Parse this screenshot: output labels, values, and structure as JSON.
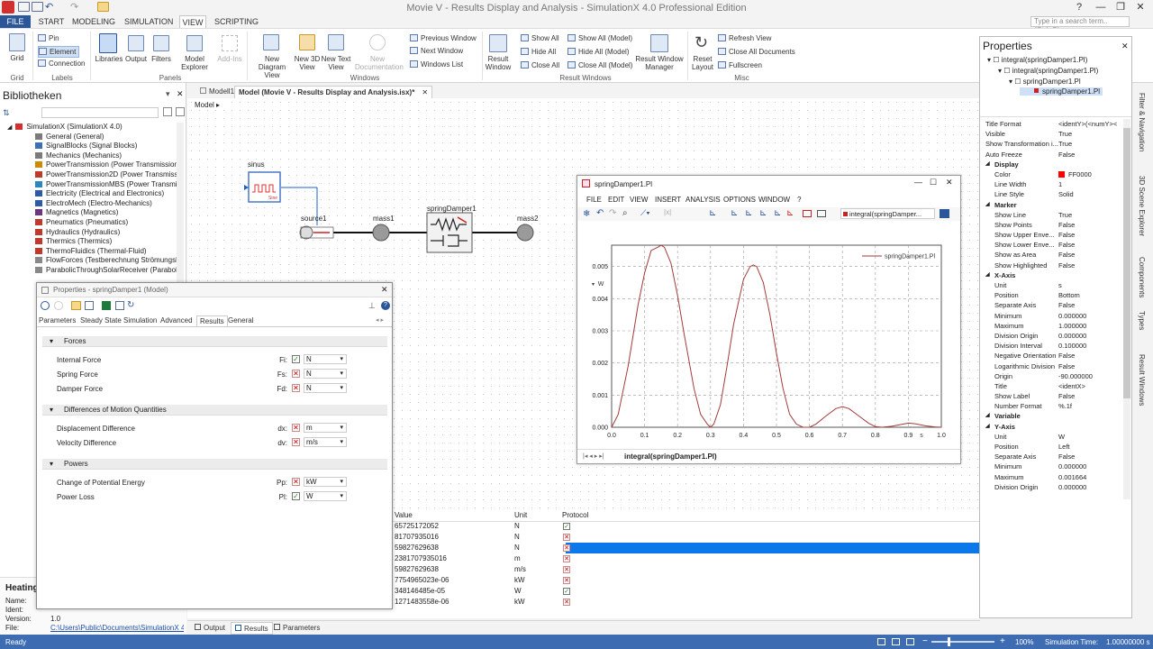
{
  "app": {
    "window_title": "Movie V - Results Display and Analysis - SimulationX 4.0 Professional Edition",
    "search_placeholder": "Type in a search term.. (Ctrl+Q)"
  },
  "menu_tabs": [
    "FILE",
    "START",
    "MODELING",
    "SIMULATION",
    "VIEW",
    "SCRIPTING"
  ],
  "ribbon": {
    "grid_label": "Grid",
    "pin": "Pin",
    "element": "Element",
    "connection": "Connection",
    "libraries": "Libraries",
    "output": "Output",
    "filters": "Filters",
    "model_explorer": "Model Explorer",
    "add_ins": "Add-Ins",
    "new_diagram_view": "New Diagram View",
    "new_3d_view": "New 3D View",
    "new_text_view": "New Text View",
    "new_documentation": "New Documentation",
    "previous_window": "Previous Window",
    "next_window": "Next Window",
    "windows_list": "Windows List",
    "result_window": "Result Window",
    "show_all": "Show All",
    "hide_all": "Hide All",
    "close_all": "Close All",
    "show_all_model": "Show All (Model)",
    "hide_all_model": "Hide All (Model)",
    "close_all_model": "Close All (Model)",
    "result_window_manager": "Result Window Manager",
    "reset_layout": "Reset Layout",
    "refresh_view": "Refresh View",
    "close_all_documents": "Close All Documents",
    "fullscreen": "Fullscreen",
    "groups": {
      "grid": "Grid",
      "labels": "Labels",
      "panels": "Panels",
      "windows": "Windows",
      "result_windows": "Result Windows",
      "misc": "Misc"
    }
  },
  "library": {
    "title": "Bibliotheken",
    "root": "SimulationX (SimulationX 4.0)",
    "items": [
      {
        "label": "General (General)",
        "color": "#7a7a7a"
      },
      {
        "label": "SignalBlocks (Signal Blocks)",
        "color": "#3b6fb6"
      },
      {
        "label": "Mechanics (Mechanics)",
        "color": "#7a7a7a"
      },
      {
        "label": "PowerTransmission (Power Transmission",
        "color": "#d08a00"
      },
      {
        "label": "PowerTransmission2D (Power Transmissi",
        "color": "#c0392b"
      },
      {
        "label": "PowerTransmissionMBS (Power Transmis",
        "color": "#2e86c1"
      },
      {
        "label": "Electricity (Electrical and Electronics)",
        "color": "#2e5aa8"
      },
      {
        "label": "ElectroMech (Electro-Mechanics)",
        "color": "#2e5aa8"
      },
      {
        "label": "Magnetics (Magnetics)",
        "color": "#6c3483"
      },
      {
        "label": "Pneumatics (Pneumatics)",
        "color": "#c0392b"
      },
      {
        "label": "Hydraulics (Hydraulics)",
        "color": "#c0392b"
      },
      {
        "label": "Thermics (Thermics)",
        "color": "#c0392b"
      },
      {
        "label": "ThermoFluidics (Thermal-Fluid)",
        "color": "#c0392b"
      },
      {
        "label": "FlowForces (Testberechnung Strömungsk",
        "color": "#888888"
      },
      {
        "label": "ParabolicThroughSolarReceiver (Parabol",
        "color": "#888888"
      }
    ],
    "info": {
      "title": "Heating",
      "name_label": "Name:",
      "ident_label": "Ident:",
      "version_label": "Version:",
      "version": "1.0",
      "file_label": "File:",
      "file": "C:\\Users\\Public\\Documents\\SimulationX 4.0"
    }
  },
  "doc_tabs": [
    "Modell1",
    "Model (Movie V - Results Display and Analysis.isx)*"
  ],
  "breadcrumb": "Model",
  "diagram": {
    "sinus": "sinus",
    "sinus_sub": "Sine",
    "source1": "source1",
    "mass1": "mass1",
    "springDamper1": "springDamper1",
    "mass2": "mass2"
  },
  "props_dialog": {
    "title": "Properties - springDamper1 (Model)",
    "tabs": [
      "Parameters",
      "Steady State Simulation",
      "Advanced",
      "Results",
      "General"
    ],
    "active_tab": "Results",
    "sections": [
      {
        "title": "Forces",
        "rows": [
          {
            "label": "Internal Force",
            "sym": "Fi:",
            "checked": true,
            "unit": "N"
          },
          {
            "label": "Spring Force",
            "sym": "Fs:",
            "checked": false,
            "unit": "N"
          },
          {
            "label": "Damper Force",
            "sym": "Fd:",
            "checked": false,
            "unit": "N"
          }
        ]
      },
      {
        "title": "Differences of Motion Quantities",
        "rows": [
          {
            "label": "Displacement Difference",
            "sym": "dx:",
            "checked": false,
            "unit": "m"
          },
          {
            "label": "Velocity Difference",
            "sym": "dv:",
            "checked": false,
            "unit": "m/s"
          }
        ]
      },
      {
        "title": "Powers",
        "rows": [
          {
            "label": "Change of Potential Energy",
            "sym": "Pp:",
            "checked": false,
            "unit": "kW"
          },
          {
            "label": "Power Loss",
            "sym": "Pl:",
            "checked": true,
            "unit": "W"
          }
        ]
      }
    ]
  },
  "results_grid": {
    "headers": [
      "Value",
      "Unit",
      "Protocol"
    ],
    "rows": [
      {
        "value": "65725172052",
        "unit": "N",
        "protocol": true
      },
      {
        "value": "81707935016",
        "unit": "N",
        "protocol": false
      },
      {
        "value": "59827629638",
        "unit": "N",
        "protocol": false
      },
      {
        "value": "2381707935016",
        "unit": "m",
        "protocol": false
      },
      {
        "value": "59827629638",
        "unit": "m/s",
        "protocol": false
      },
      {
        "value": "7754965023e-06",
        "unit": "kW",
        "protocol": false
      },
      {
        "value": "348146485e-05",
        "unit": "W",
        "protocol": true
      },
      {
        "value": "1271483558e-06",
        "unit": "kW",
        "protocol": false
      }
    ],
    "selected_row": 2
  },
  "bottom_tabs": [
    "Output",
    "Results",
    "Parameters"
  ],
  "plot": {
    "title": "springDamper1.Pl",
    "menu": [
      "FILE",
      "EDIT",
      "VIEW",
      "INSERT",
      "ANALYSIS",
      "OPTIONS",
      "WINDOW",
      "?"
    ],
    "combo": "integral(springDamper...",
    "tab": "integral(springDamper1.Pl)",
    "y_unit_label": "W",
    "x_unit_label": "s"
  },
  "chart_data": {
    "type": "line",
    "title": "",
    "xlabel": "s",
    "ylabel": "W",
    "xlim": [
      0,
      1
    ],
    "ylim": [
      0,
      0.005664
    ],
    "x_ticks": [
      "0.0",
      "0.1",
      "0.2",
      "0.3",
      "0.4",
      "0.5",
      "0.6",
      "0.7",
      "0.8",
      "0.9",
      "1.0"
    ],
    "y_ticks": [
      "0.000",
      "0.001",
      "0.002",
      "0.003",
      "0.004",
      "0.005"
    ],
    "grid": true,
    "legend_position": "top-right",
    "series": [
      {
        "name": "springDamper1.Pl",
        "color": "#a33a3a",
        "x": [
          0,
          0.02,
          0.05,
          0.08,
          0.1,
          0.12,
          0.14,
          0.15,
          0.16,
          0.18,
          0.2,
          0.22,
          0.25,
          0.27,
          0.29,
          0.3,
          0.31,
          0.33,
          0.35,
          0.37,
          0.4,
          0.42,
          0.43,
          0.44,
          0.46,
          0.48,
          0.5,
          0.52,
          0.54,
          0.56,
          0.58,
          0.6,
          0.62,
          0.65,
          0.68,
          0.7,
          0.72,
          0.75,
          0.78,
          0.8,
          0.82,
          0.85,
          0.88,
          0.9,
          0.92,
          0.95,
          0.98,
          1.0
        ],
        "y": [
          0,
          0.0004,
          0.0019,
          0.0038,
          0.0048,
          0.0055,
          0.0056,
          0.00566,
          0.0056,
          0.0051,
          0.0041,
          0.0029,
          0.0012,
          0.0004,
          0.0001,
          0,
          0.0001,
          0.0007,
          0.0019,
          0.0032,
          0.0046,
          0.005,
          0.00505,
          0.005,
          0.0045,
          0.0035,
          0.0023,
          0.0012,
          0.0004,
          0.0001,
          0,
          0,
          0.0001,
          0.00035,
          0.00058,
          0.00064,
          0.00058,
          0.00035,
          0.00012,
          2e-05,
          0,
          3e-05,
          9e-05,
          0.00013,
          0.00011,
          5e-05,
          1e-05,
          0
        ]
      }
    ]
  },
  "properties": {
    "title": "Properties",
    "tree": [
      "integral(springDamper1.Pl)",
      "integral(springDamper1.Pl)",
      "springDamper1.Pl",
      "springDamper1.Pl"
    ],
    "rows": [
      {
        "k": "Title Format",
        "v": "<identY>(<numY><"
      },
      {
        "k": "Visible",
        "v": "True"
      },
      {
        "k": "Show Transformation i...",
        "v": "True"
      },
      {
        "k": "Auto Freeze",
        "v": "False"
      },
      {
        "k": "Display",
        "v": "",
        "sec": true
      },
      {
        "k": "Color",
        "v": "FF0000",
        "swatch": "#ff0000"
      },
      {
        "k": "Line Width",
        "v": "1"
      },
      {
        "k": "Line Style",
        "v": "Solid"
      },
      {
        "k": "Marker",
        "v": "",
        "sec": true
      },
      {
        "k": "Show Line",
        "v": "True"
      },
      {
        "k": "Show Points",
        "v": "False"
      },
      {
        "k": "Show Upper Enve...",
        "v": "False"
      },
      {
        "k": "Show Lower Enve...",
        "v": "False"
      },
      {
        "k": "Show as Area",
        "v": "False"
      },
      {
        "k": "Show Highlighted",
        "v": "False"
      },
      {
        "k": "X-Axis",
        "v": "",
        "sec": true
      },
      {
        "k": "Unit",
        "v": "s"
      },
      {
        "k": "Position",
        "v": "Bottom"
      },
      {
        "k": "Separate Axis",
        "v": "False"
      },
      {
        "k": "Minimum",
        "v": "0.000000"
      },
      {
        "k": "Maximum",
        "v": "1.000000"
      },
      {
        "k": "Division Origin",
        "v": "0.000000"
      },
      {
        "k": "Division Interval",
        "v": "0.100000"
      },
      {
        "k": "Negative Orientation",
        "v": "False"
      },
      {
        "k": "Logarithmic Division",
        "v": "False"
      },
      {
        "k": "Origin",
        "v": "-90.000000"
      },
      {
        "k": "Title",
        "v": "<identX>"
      },
      {
        "k": "Show Label",
        "v": "False"
      },
      {
        "k": "Number Format",
        "v": "%.1f"
      },
      {
        "k": "Variable",
        "v": "",
        "sec": true
      },
      {
        "k": "Y-Axis",
        "v": "",
        "sec": true
      },
      {
        "k": "Unit",
        "v": "W"
      },
      {
        "k": "Position",
        "v": "Left"
      },
      {
        "k": "Separate Axis",
        "v": "False"
      },
      {
        "k": "Minimum",
        "v": "0.000000"
      },
      {
        "k": "Maximum",
        "v": "0.001664"
      },
      {
        "k": "Division Origin",
        "v": "0.000000"
      }
    ]
  },
  "right_dock": [
    "Filter & Navigation",
    "3D Scene Explorer",
    "Components",
    "Types",
    "Result Windows"
  ],
  "status": {
    "left": "Ready",
    "zoom": "100%",
    "sim_label": "Simulation Time:",
    "sim_value": "1.00000000 s"
  }
}
